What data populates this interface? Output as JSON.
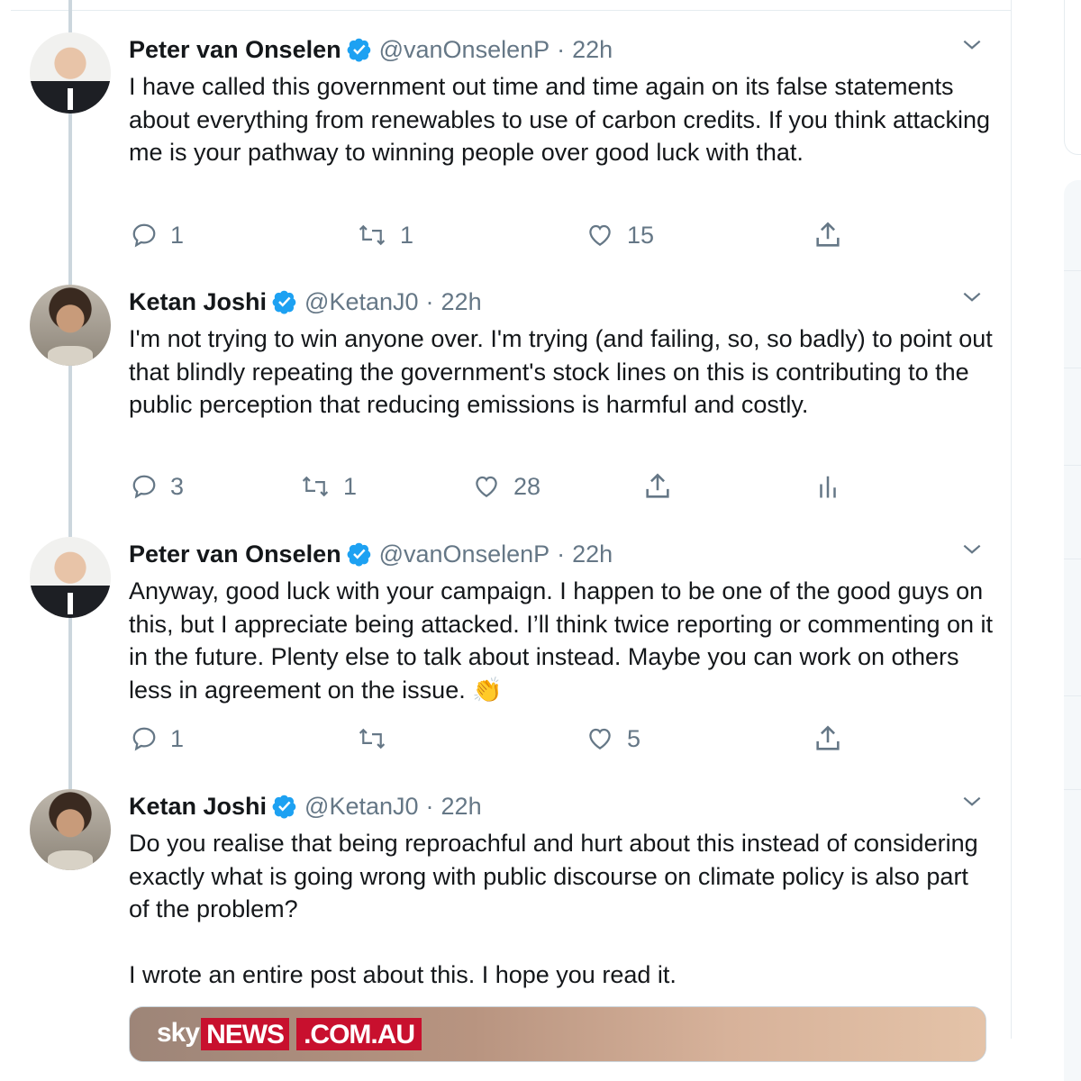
{
  "colors": {
    "accent": "#1da1f2",
    "muted": "#657786",
    "text": "#14171a",
    "thread_line": "#ccd6dd"
  },
  "tweets": [
    {
      "name": "Peter van Onselen",
      "handle": "@vanOnselenP",
      "sep": "·",
      "time": "22h",
      "verified": true,
      "text": "I have called this government out time and time again on its false statements about everything from renewables to use of carbon credits. If you think attacking me is your pathway to winning people over good luck with that.",
      "replies": "1",
      "retweets": "1",
      "likes": "15"
    },
    {
      "name": "Ketan Joshi",
      "handle": "@KetanJ0",
      "sep": "·",
      "time": "22h",
      "verified": true,
      "text": "I'm not trying to win anyone over. I'm trying (and failing, so, so badly) to point out that blindly repeating the government's stock lines on this is contributing to the public perception that reducing emissions is harmful and costly.",
      "replies": "3",
      "retweets": "1",
      "likes": "28"
    },
    {
      "name": "Peter van Onselen",
      "handle": "@vanOnselenP",
      "sep": "·",
      "time": "22h",
      "verified": true,
      "text": "Anyway, good luck with your campaign. I happen to be one of the good guys on this, but I appreciate being attacked. I’ll think twice reporting or commenting on it in the future. Plenty else to talk about instead. Maybe you can work on others less in agreement on the issue. 👏",
      "replies": "1",
      "retweets": "",
      "likes": "5"
    },
    {
      "name": "Ketan Joshi",
      "handle": "@KetanJ0",
      "sep": "·",
      "time": "22h",
      "verified": true,
      "text": "Do you realise that being reproachful and hurt about this instead of considering exactly what is going wrong with public discourse on climate policy is also part of the problem?\n\nI wrote an entire post about this. I hope you read it."
    }
  ],
  "media_card": {
    "logo_sky": "sky",
    "logo_news": "NEWS",
    "logo_domain": ".COM.AU"
  },
  "icons": {
    "reply": "reply-icon",
    "retweet": "retweet-icon",
    "like": "heart-icon",
    "share": "share-icon",
    "analytics": "analytics-icon",
    "more": "chevron-down-icon",
    "verified": "verified-badge-icon"
  }
}
